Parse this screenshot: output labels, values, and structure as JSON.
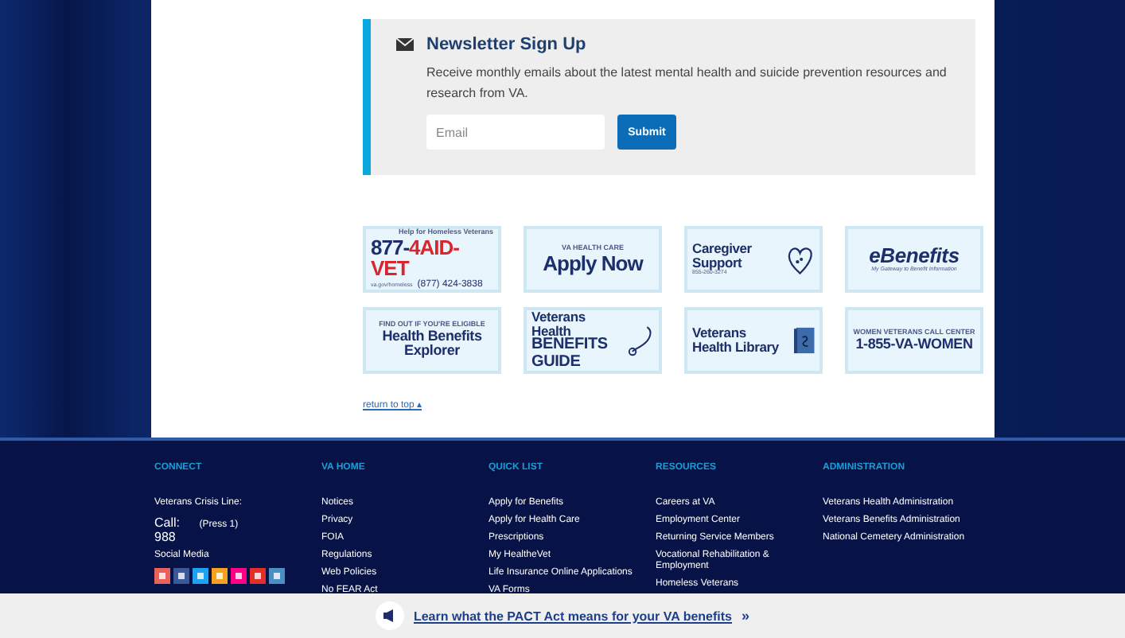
{
  "newsletter": {
    "title": "Newsletter Sign Up",
    "text": "Receive monthly emails about the latest mental health and suicide prevention resources and research from VA.",
    "email": {
      "placeholder": "Email"
    },
    "submit": "Submit"
  },
  "banners": [
    {
      "kind": "hotline",
      "top": "Help for Homeless Veterans",
      "main": "877-",
      "main_accent": "4AID-VET",
      "bottom": "va.gov/homeless",
      "bottom_2": "(877) 424-3838"
    },
    {
      "kind": "plain",
      "top": "VA HEALTH CARE",
      "main": "Apply Now"
    },
    {
      "kind": "heart",
      "main": "Caregiver Support",
      "bottom": "855-260-3274"
    },
    {
      "kind": "logo",
      "main": "eBenefits",
      "bottom": "My Gateway to Benefit Information"
    },
    {
      "kind": "plain",
      "top": "FIND OUT IF YOU'RE ELIGIBLE",
      "main": "Health Benefits Explorer"
    },
    {
      "kind": "stethoscope",
      "top": "Veterans Health",
      "main": "BENEFITS GUIDE"
    },
    {
      "kind": "book",
      "main": "Veterans Health Library"
    },
    {
      "kind": "plain",
      "top": "WOMEN VETERANS CALL CENTER",
      "main": "1-855-VA-WOMEN"
    }
  ],
  "return_to_top": "return to top ▴",
  "connect": {
    "heading": "CONNECT",
    "crisis_label": "Veterans Crisis Line:",
    "call": "Call: 988",
    "press": "(Press 1)",
    "social_label": "Social Media"
  },
  "footer_columns": [
    {
      "heading": "VA HOME",
      "links": [
        "Notices",
        "Privacy",
        "FOIA",
        "Regulations",
        "Web Policies",
        "No FEAR Act"
      ]
    },
    {
      "heading": "QUICK LIST",
      "links": [
        "Apply for Benefits",
        "Apply for Health Care",
        "Prescriptions",
        "My HealtheVet",
        "Life Insurance Online Applications",
        "VA Forms"
      ]
    },
    {
      "heading": "RESOURCES",
      "links": [
        "Careers at VA",
        "Employment Center",
        "Returning Service Members",
        "Vocational Rehabilitation & Employment",
        "Homeless Veterans"
      ]
    },
    {
      "heading": "ADMINISTRATION",
      "links": [
        "Veterans Health Administration",
        "Veterans Benefits Administration",
        "National Cemetery Administration"
      ]
    }
  ],
  "pact_banner": {
    "link": "Learn what the PACT Act means for your VA benefits",
    "arrow": "»"
  }
}
